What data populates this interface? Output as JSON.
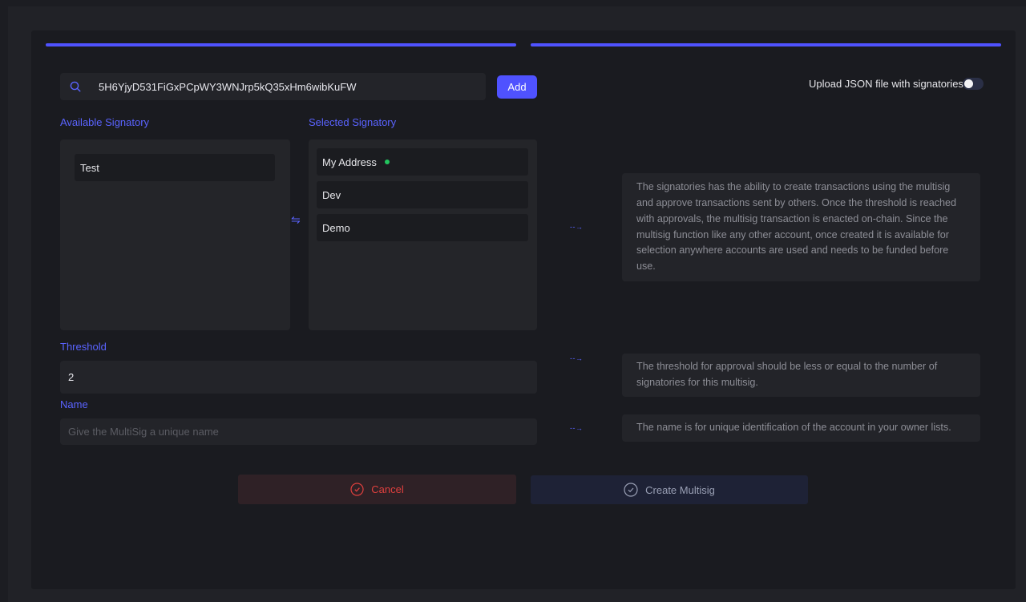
{
  "search": {
    "value": "5H6YjyD531FiGxPCpWY3WNJrp5kQ35xHm6wibKuFW",
    "placeholder": ""
  },
  "add_button": "Add",
  "upload": {
    "label": "Upload JSON file with signatories",
    "enabled": false
  },
  "available": {
    "label": "Available Signatory",
    "items": [
      "Test"
    ]
  },
  "selected": {
    "label": "Selected Signatory",
    "items": [
      {
        "name": "My Address",
        "status_dot": "#22c55e"
      },
      {
        "name": "Dev"
      },
      {
        "name": "Demo"
      }
    ]
  },
  "help": {
    "signatories": "The signatories has the ability to create transactions using the multisig and approve transactions sent by others. Once the threshold is reached with approvals, the multisig transaction is enacted on-chain. Since the multisig function like any other account, once created it is available for selection anywhere accounts are used and needs to be funded before use.",
    "threshold": "The threshold for approval should be less or equal to the number of signatories for this multisig.",
    "name": "The name is for unique identification of the account in your owner lists."
  },
  "threshold": {
    "label": "Threshold",
    "value": "2"
  },
  "name": {
    "label": "Name",
    "value": "",
    "placeholder": "Give the MultiSig a unique name"
  },
  "actions": {
    "cancel": "Cancel",
    "create": "Create Multisig"
  },
  "colors": {
    "accent": "#4f52ff",
    "danger": "#e0403e",
    "background": "#1a1b20"
  }
}
